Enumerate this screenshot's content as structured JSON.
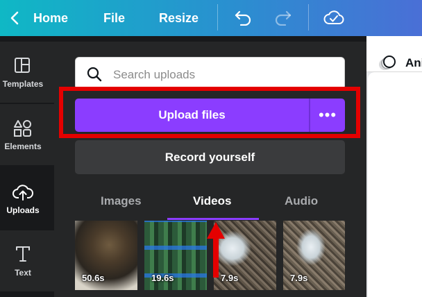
{
  "topbar": {
    "back_label": "Home",
    "file_label": "File",
    "resize_label": "Resize"
  },
  "rail": {
    "items": [
      {
        "label": "Templates",
        "icon": "templates-icon"
      },
      {
        "label": "Elements",
        "icon": "elements-icon"
      },
      {
        "label": "Uploads",
        "icon": "uploads-icon"
      },
      {
        "label": "Text",
        "icon": "text-icon"
      }
    ],
    "active": "Uploads"
  },
  "panel": {
    "search_placeholder": "Search uploads",
    "upload_label": "Upload files",
    "more_label": "•••",
    "record_label": "Record yourself",
    "tabs": [
      {
        "label": "Images"
      },
      {
        "label": "Videos"
      },
      {
        "label": "Audio"
      }
    ],
    "active_tab": "Videos",
    "videos": [
      {
        "duration": "50.6s"
      },
      {
        "duration": "19.6s"
      },
      {
        "duration": "7.9s"
      },
      {
        "duration": "7.9s"
      }
    ]
  },
  "canvas": {
    "toolbar_label": "Ani"
  },
  "colors": {
    "accent": "#8b3dff",
    "highlight": "#e40000",
    "panel_bg": "#252627"
  }
}
